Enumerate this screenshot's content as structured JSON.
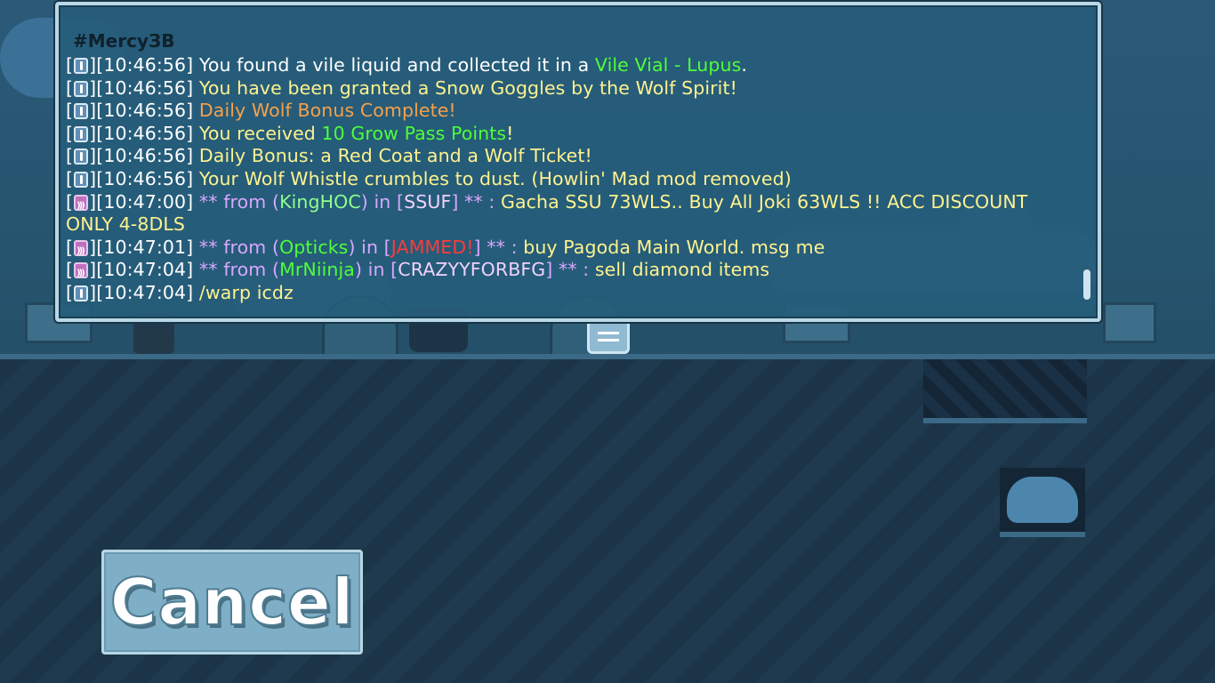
{
  "chat": {
    "partial_top_line": "#MercyЗВ",
    "lines": [
      {
        "icon": "info",
        "time": "[10:46:56]",
        "parts": [
          {
            "t": "You found a vile liquid and collected it in a ",
            "c": "cw"
          },
          {
            "t": "Vile Vial - Lupus",
            "c": "cg"
          },
          {
            "t": ".",
            "c": "cw"
          }
        ]
      },
      {
        "icon": "info",
        "time": "[10:46:56]",
        "parts": [
          {
            "t": "You have been granted a Snow Goggles by the Wolf Spirit!",
            "c": "cy"
          }
        ]
      },
      {
        "icon": "info",
        "time": "[10:46:56]",
        "parts": [
          {
            "t": "Daily Wolf Bonus Complete!",
            "c": "co"
          }
        ]
      },
      {
        "icon": "info",
        "time": "[10:46:56]",
        "parts": [
          {
            "t": "You received ",
            "c": "cy"
          },
          {
            "t": "10 Grow Pass Points",
            "c": "cg"
          },
          {
            "t": "!",
            "c": "cy"
          }
        ]
      },
      {
        "icon": "info",
        "time": "[10:46:56]",
        "parts": [
          {
            "t": "Daily Bonus:",
            "c": "cy"
          },
          {
            "t": " a Red Coat and a Wolf Ticket!",
            "c": "cy"
          }
        ]
      },
      {
        "icon": "info",
        "time": "[10:46:56]",
        "parts": [
          {
            "t": "Your Wolf Whistle crumbles to dust. (Howlin' Mad mod removed)",
            "c": "cy"
          }
        ]
      },
      {
        "icon": "msg",
        "time": "[10:47:00]",
        "wrap": true,
        "parts": [
          {
            "t": "  ** from (",
            "c": "cp"
          },
          {
            "t": "KingHOC",
            "c": "cgl"
          },
          {
            "t": ") in [",
            "c": "cp"
          },
          {
            "t": "SSUF",
            "c": "clav"
          },
          {
            "t": "] ** : ",
            "c": "cp"
          },
          {
            "t": "Gacha SSU 73WLS.. Buy All Joki 63WLS !! ACC DISCOUNT ONLY 4-8DLS",
            "c": "cy"
          }
        ]
      },
      {
        "icon": "msg",
        "time": "[10:47:01]",
        "parts": [
          {
            "t": "  ** from (",
            "c": "cp"
          },
          {
            "t": "Opticks",
            "c": "cg"
          },
          {
            "t": ") in [",
            "c": "cp"
          },
          {
            "t": "JAMMED!",
            "c": "cr"
          },
          {
            "t": "] ** : ",
            "c": "cp"
          },
          {
            "t": "buy Pagoda Main World. msg me",
            "c": "cy"
          }
        ]
      },
      {
        "icon": "msg",
        "time": "[10:47:04]",
        "parts": [
          {
            "t": "  ** from (",
            "c": "cp"
          },
          {
            "t": "MrNiinja",
            "c": "cg"
          },
          {
            "t": ") in [",
            "c": "cp"
          },
          {
            "t": "CRAZYYFORBFG",
            "c": "clav"
          },
          {
            "t": "] ** : ",
            "c": "cp"
          },
          {
            "t": "sell diamond items",
            "c": "cy"
          }
        ]
      },
      {
        "icon": "info",
        "time": "[10:47:04]",
        "parts": [
          {
            "t": "  /warp icdz",
            "c": "cy"
          }
        ]
      }
    ]
  },
  "cancel_button": {
    "label": "Cancel"
  },
  "icons": {
    "info": "info-icon",
    "msg": "private-message-icon",
    "chat_toggle": "menu-lines-icon"
  }
}
